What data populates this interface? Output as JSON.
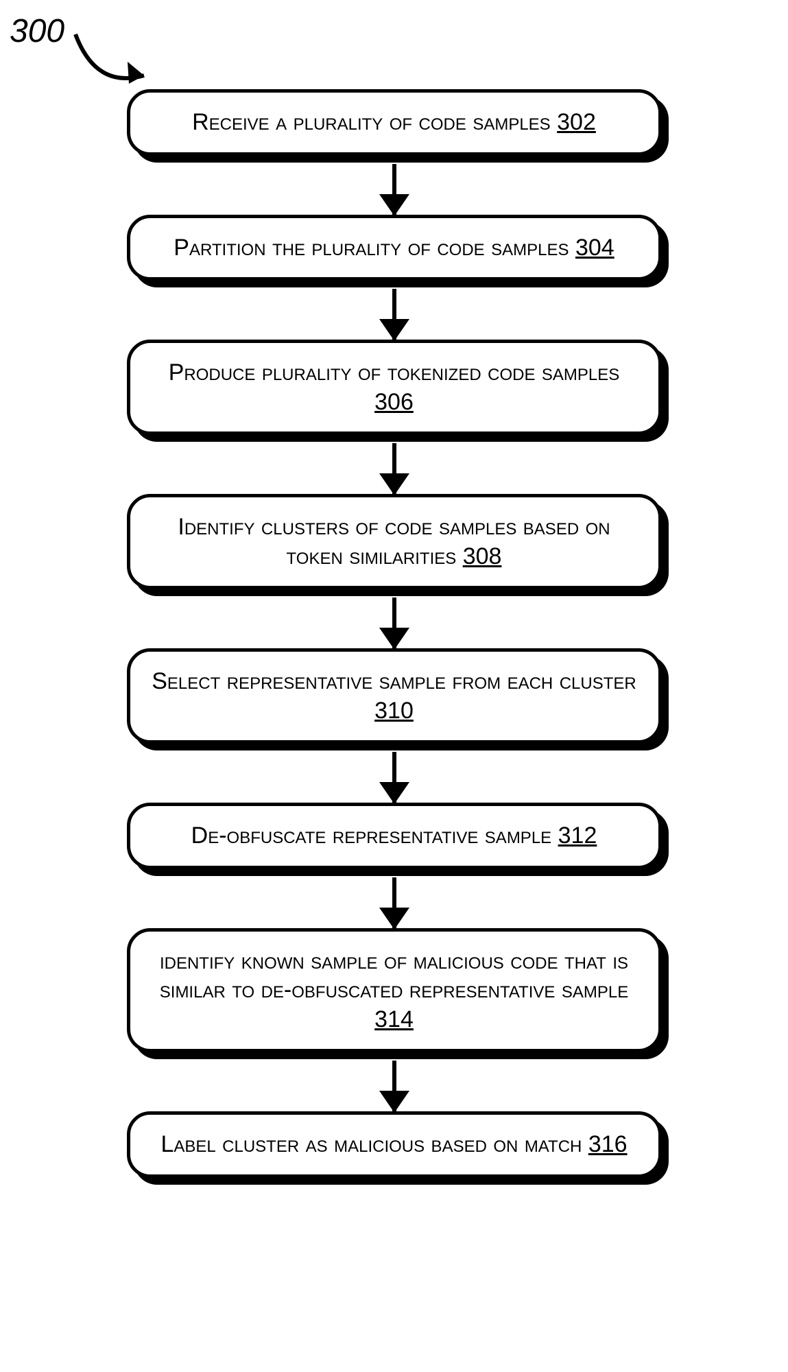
{
  "figure_label": "300",
  "steps": [
    {
      "text": "Receive a plurality of code samples",
      "ref": "302",
      "multiline": false
    },
    {
      "text": "Partition the plurality of code samples",
      "ref": "304",
      "multiline": true
    },
    {
      "text": "Produce plurality of tokenized code samples",
      "ref": "306",
      "multiline": true
    },
    {
      "text": "Identify clusters of code samples based on token similarities",
      "ref": "308",
      "multiline": true
    },
    {
      "text": "Select representative sample from each cluster",
      "ref": "310",
      "multiline": true
    },
    {
      "text": "De-obfuscate representative sample",
      "ref": "312",
      "multiline": false
    },
    {
      "text": "identify known sample of malicious code that is similar to de-obfuscated representative sample",
      "ref": "314",
      "multiline": true
    },
    {
      "text": "Label cluster as malicious based on match",
      "ref": "316",
      "multiline": true
    }
  ],
  "arrow_heights": [
    74,
    74,
    74,
    74,
    74,
    74,
    74
  ]
}
